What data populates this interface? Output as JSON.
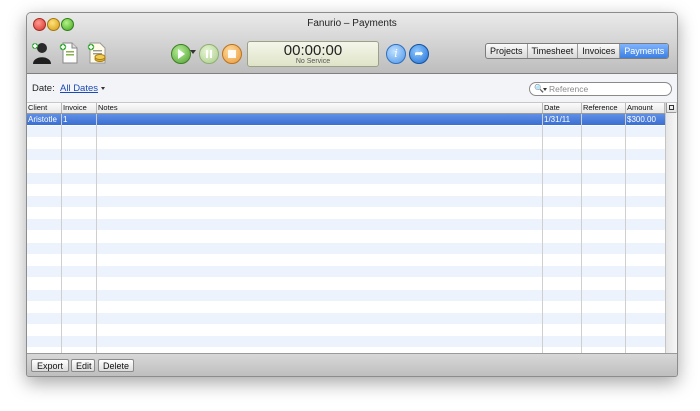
{
  "window": {
    "title": "Fanurio – Payments"
  },
  "toolbar": {
    "timer_time": "00:00:00",
    "timer_status": "No Service",
    "views": [
      "Projects",
      "Timesheet",
      "Invoices",
      "Payments"
    ],
    "active_view": "Payments"
  },
  "filter": {
    "date_label": "Date:",
    "date_value": "All Dates",
    "search_placeholder": "Reference"
  },
  "table": {
    "columns": [
      "Client",
      "Invoice",
      "Notes",
      "Date",
      "Reference",
      "Amount"
    ],
    "rows": [
      {
        "client": "Aristotle",
        "invoice": "1",
        "notes": "",
        "date": "1/31/11",
        "reference": "",
        "amount": "$300.00",
        "selected": true
      }
    ]
  },
  "actions": {
    "export": "Export",
    "edit": "Edit",
    "delete": "Delete"
  },
  "colors": {
    "selection": "#3a6fd1",
    "stripe": "#edf3fd",
    "active_tab": "#3c7fe0"
  },
  "icons": [
    "client-icon",
    "new-document-icon",
    "new-invoice-icon",
    "play-icon",
    "pause-icon",
    "stop-icon",
    "info-icon",
    "sync-icon",
    "search-icon",
    "column-picker-icon"
  ]
}
